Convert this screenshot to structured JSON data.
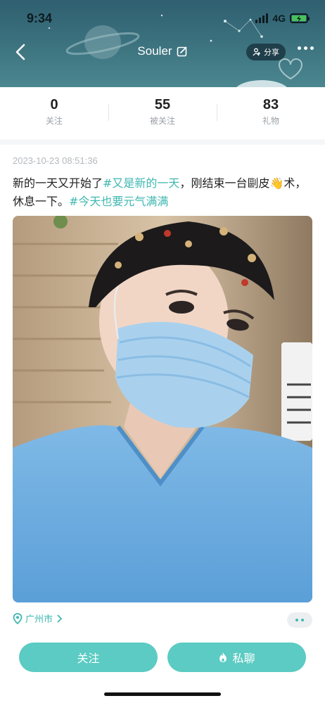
{
  "status_bar": {
    "time": "9:34",
    "network": "4G"
  },
  "nav": {
    "title": "Souler",
    "share_label": "分享"
  },
  "stats": [
    {
      "value": "0",
      "label": "关注"
    },
    {
      "value": "55",
      "label": "被关注"
    },
    {
      "value": "83",
      "label": "礼物"
    }
  ],
  "post": {
    "timestamp": "2023-10-23 08:51:36",
    "text_1": "新的一天又开始了",
    "tag_1": "#又是新的一天",
    "text_2": "，刚结束一台剾皮👋术，休息一下。",
    "tag_2": "#今天也要元气满满",
    "location": "广州市"
  },
  "actions": {
    "follow_label": "关注",
    "chat_label": "私聊"
  },
  "colors": {
    "accent": "#5bcbc3",
    "tag": "#3fb8b0",
    "header": "#3d7480"
  }
}
